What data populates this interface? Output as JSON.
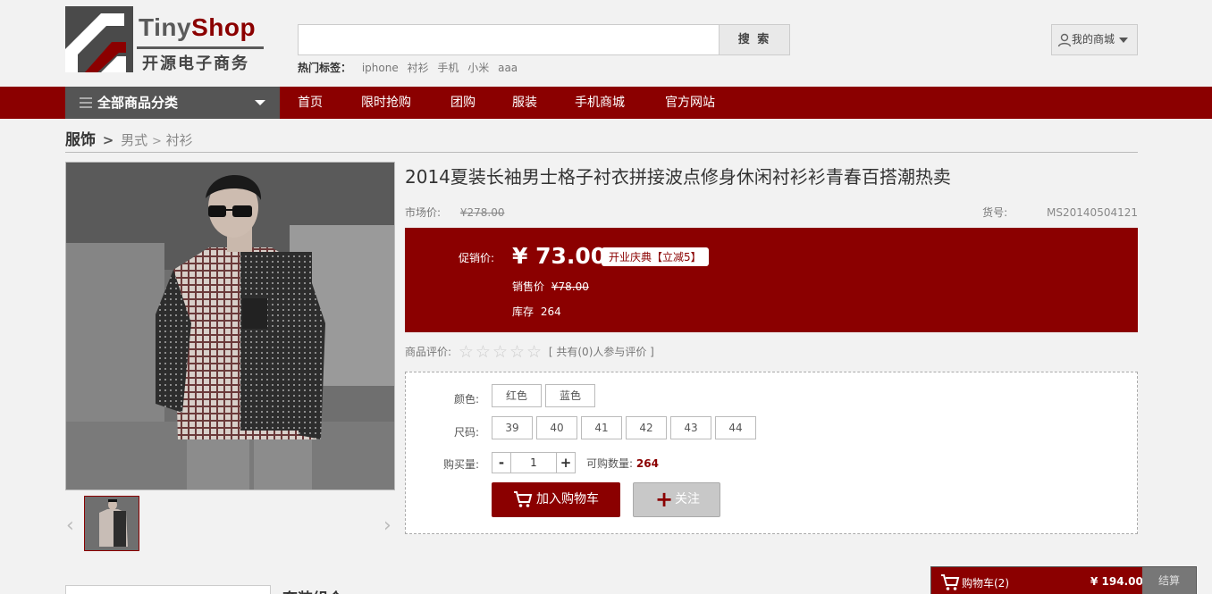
{
  "logo": {
    "brand_a": "Tiny",
    "brand_b": "Shop",
    "subtitle": "开源电子商务"
  },
  "search": {
    "placeholder": "",
    "button": "搜 索",
    "hot_label": "热门标签：",
    "hot_tags": [
      "iphone",
      "衬衫",
      "手机",
      "小米",
      "aaa"
    ]
  },
  "user": {
    "mymall": "我的商城"
  },
  "nav": {
    "categories": "全部商品分类",
    "links": [
      "首页",
      "限时抢购",
      "团购",
      "服装",
      "手机商城",
      "官方网站"
    ]
  },
  "breadcrumb": {
    "level1": "服饰",
    "sep": ">",
    "level2": "男式",
    "level3": "衬衫"
  },
  "product": {
    "title": "2014夏装长袖男士格子衬衣拼接波点修身休闲衬衫衫青春百搭潮热卖",
    "market_label": "市场价:",
    "market_price": "¥278.00",
    "sku_label": "货号:",
    "sku": "MS20140504121",
    "promo_label": "促销价:",
    "promo_price": "¥ 73.00",
    "promo_badge": "开业庆典【立减5】",
    "sale_label": "销售价",
    "sale_price": "¥78.00",
    "stock_label": "库存",
    "stock": "264",
    "rating_label": "商品评价:",
    "rating_text": "[ 共有(0)人参与评价 ]",
    "rating_stars": 0,
    "color_label": "颜色:",
    "colors": [
      "红色",
      "蓝色"
    ],
    "size_label": "尺码:",
    "sizes": [
      "39",
      "40",
      "41",
      "42",
      "43",
      "44"
    ],
    "qty_label": "购买量:",
    "qty": "1",
    "qty_minus": "-",
    "qty_plus": "+",
    "avail_label": "可购数量:",
    "avail": "264",
    "add_cart": "加入购物车",
    "follow": "关注"
  },
  "bottom": {
    "section_title": "套装组合"
  },
  "cart": {
    "label": "购物车(2)",
    "total": "¥ 194.00",
    "checkout": "结算"
  },
  "colors": {
    "accent": "#8b0000",
    "nav_dark": "#555555"
  }
}
